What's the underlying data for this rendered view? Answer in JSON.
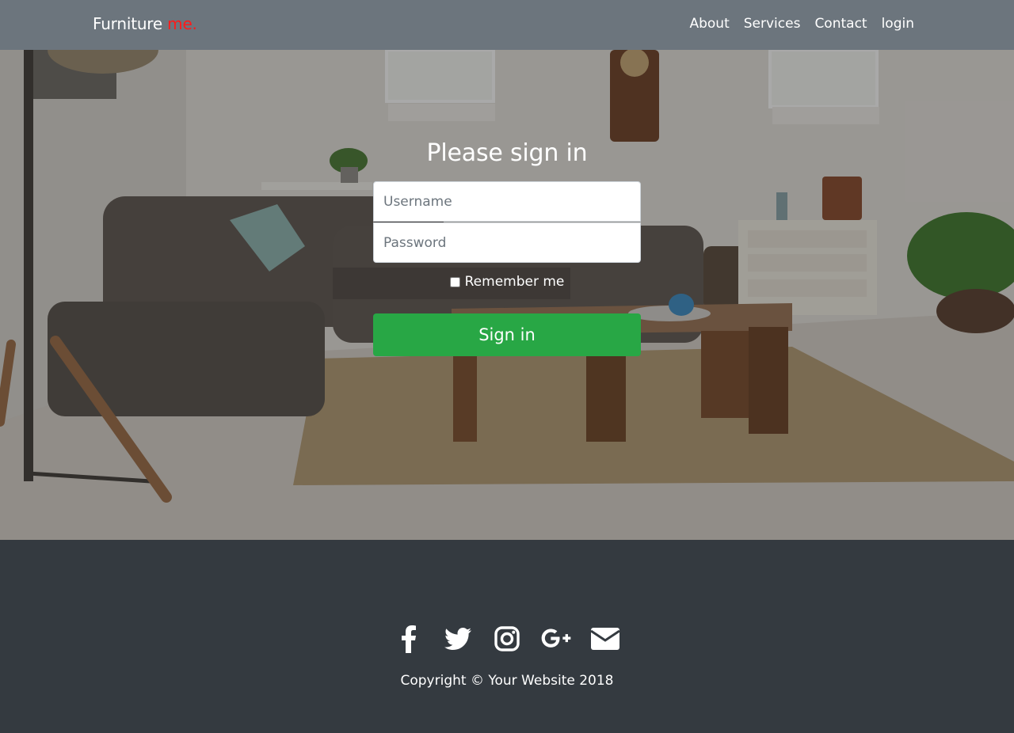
{
  "brand": {
    "name": "Furniture",
    "accent": "me."
  },
  "nav": {
    "items": [
      {
        "label": "About"
      },
      {
        "label": "Services"
      },
      {
        "label": "Contact"
      },
      {
        "label": "login"
      }
    ]
  },
  "form": {
    "title": "Please sign in",
    "username_placeholder": "Username",
    "password_placeholder": "Password",
    "remember_label": "Remember me",
    "submit_label": "Sign in"
  },
  "footer": {
    "social": [
      "facebook-icon",
      "twitter-icon",
      "instagram-icon",
      "google-plus-icon",
      "envelope-icon"
    ],
    "copyright": "Copyright © Your Website 2018"
  },
  "colors": {
    "nav": "#6c757d",
    "footer": "#343a40",
    "accent": "#ff1a1a",
    "button": "#28a745"
  }
}
